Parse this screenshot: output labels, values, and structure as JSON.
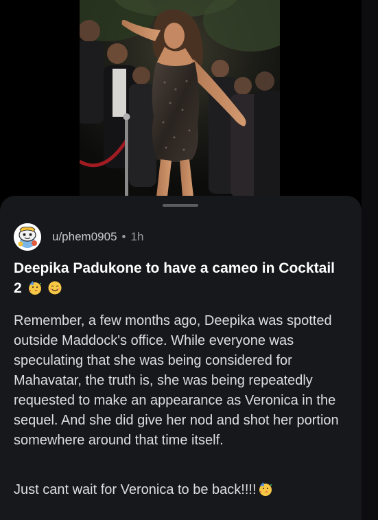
{
  "post": {
    "username": "u/phem0905",
    "separator": "•",
    "age": "1h",
    "title": "Deepika Padukone to have a cameo in Cocktail 2",
    "title_emojis": [
      "partying-face",
      "smiling-face"
    ],
    "body": "Remember, a few months ago, Deepika was spotted outside Maddock's office. While everyone was speculating that she was being considered for Mahavatar, the truth is, she was being repeatedly requested to make an appearance as Veronica in the sequel. And she did give her nod and shot her portion somewhere around that time itself.",
    "closing": "Just cant wait for Veronica to be back!!!!",
    "closing_emoji": "partying-face"
  },
  "colors": {
    "background": "#000000",
    "sheet": "#17181b",
    "title": "#ffffff",
    "body": "#dedfe1",
    "meta": "#9a9ca1"
  }
}
